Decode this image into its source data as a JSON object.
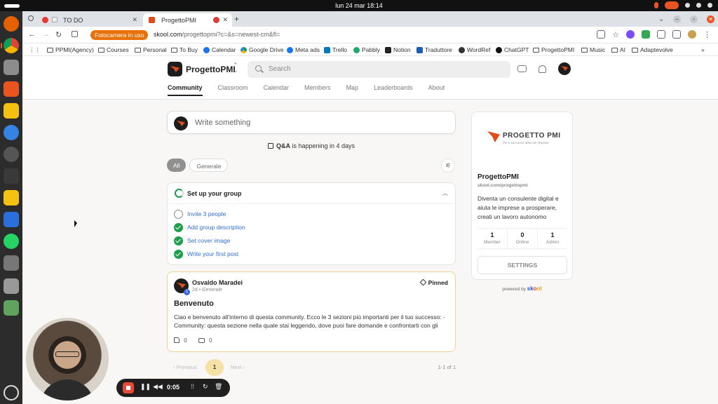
{
  "system": {
    "clock": "lun 24 mar  18:14"
  },
  "browser": {
    "tabs": [
      {
        "label": "TO DO",
        "active": false
      },
      {
        "label": "ProgettoPMI",
        "active": true
      }
    ],
    "camera_badge": "Fotocamera in uso",
    "url_host": "skool.com",
    "url_path": "/progettopmi?c=&s=newest-cm&fl=",
    "bookmarks": [
      "PPMI(Agency)",
      "Courses",
      "Personal",
      "To Buy",
      "Calendar",
      "Google Drive",
      "Meta ads",
      "Trello",
      "Pabbly",
      "Notion",
      "Traduttore",
      "WordRef",
      "ChatGPT",
      "ProgettoPMI",
      "Music",
      "AI",
      "Adaptevolve"
    ]
  },
  "site": {
    "group_name": "ProgettoPMI",
    "search_placeholder": "Search",
    "nav": [
      "Community",
      "Classroom",
      "Calendar",
      "Members",
      "Map",
      "Leaderboards",
      "About"
    ]
  },
  "feed": {
    "write_placeholder": "Write something",
    "event_bold": "Q&A",
    "event_rest": " is happening in 4 days",
    "filters": [
      "All",
      "Generale"
    ],
    "setup": {
      "title": "Set up your group",
      "tasks": [
        {
          "label": "Invite 3 people",
          "done": false
        },
        {
          "label": "Add group description",
          "done": true
        },
        {
          "label": "Set cover image",
          "done": true
        },
        {
          "label": "Write your first post",
          "done": true
        }
      ]
    },
    "post": {
      "author": "Osvaldo Maradei",
      "level": "1",
      "meta": "2d • Generale",
      "pinned": "Pinned",
      "title": "Benvenuto",
      "body": "Ciao e benvenuto all'interno di questa community. Ecco le 3 sezioni più importanti per il tuo successo: - Community: questa sezione nella quale stai leggendo, dove puoi fare domande e confrontarti con gli",
      "likes": "0",
      "comments": "0"
    },
    "pager": {
      "prev": "Previous",
      "page": "1",
      "next": "Next",
      "count": "1-1 of 1"
    }
  },
  "sidebar": {
    "cover_brand": "PROGETTO PMI",
    "cover_tagline": "Per il successo delle tue imprese",
    "name": "ProgettoPMI",
    "url": "skool.com/progettopmi",
    "description": "Diventa un consulente digital e aiuta le imprese a prosperare, creati un lavoro autonomo",
    "stats": [
      {
        "value": "1",
        "label": "Member"
      },
      {
        "value": "0",
        "label": "Online"
      },
      {
        "value": "1",
        "label": "Admin"
      }
    ],
    "settings_label": "SETTINGS",
    "powered_by": "powered by",
    "skool": {
      "s1": "sk",
      "s2": "o",
      "s3": "ol"
    }
  },
  "recorder": {
    "time": "0:05"
  }
}
